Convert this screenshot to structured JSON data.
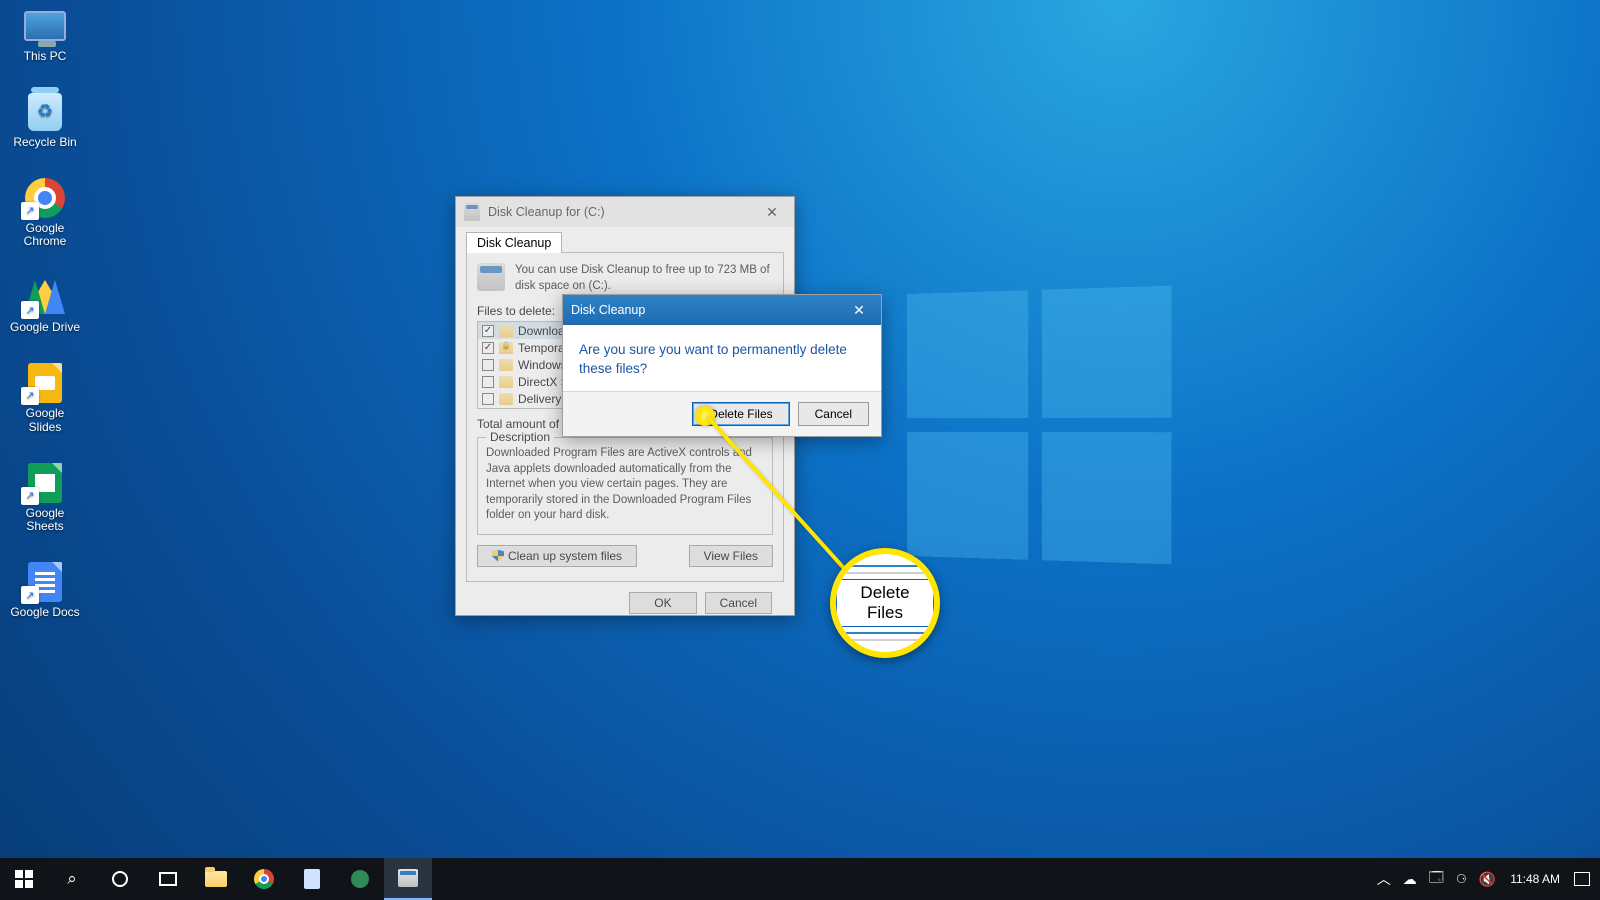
{
  "desktop_icons": [
    {
      "label": "This PC"
    },
    {
      "label": "Recycle Bin"
    },
    {
      "label": "Google Chrome"
    },
    {
      "label": "Google Drive"
    },
    {
      "label": "Google Slides"
    },
    {
      "label": "Google Sheets"
    },
    {
      "label": "Google Docs"
    }
  ],
  "cleanup_dialog": {
    "title": "Disk Cleanup for  (C:)",
    "tab": "Disk Cleanup",
    "info": "You can use Disk Cleanup to free up to 723 MB of disk space on  (C:).",
    "files_to_delete_label": "Files to delete:",
    "items": [
      {
        "checked": true,
        "label": "Downloaded Program Files",
        "locked": false
      },
      {
        "checked": true,
        "label": "Temporary Internet Files",
        "locked": true
      },
      {
        "checked": false,
        "label": "Windows error reports",
        "locked": false
      },
      {
        "checked": false,
        "label": "DirectX Shader Cache",
        "locked": false
      },
      {
        "checked": false,
        "label": "Delivery Optimization Files",
        "locked": false
      }
    ],
    "total_label": "Total amount of disk space you gain:",
    "description_legend": "Description",
    "description_text": "Downloaded Program Files are ActiveX controls and Java applets downloaded automatically from the Internet when you view certain pages. They are temporarily stored in the Downloaded Program Files folder on your hard disk.",
    "clean_system_btn": "Clean up system files",
    "view_files_btn": "View Files",
    "ok_btn": "OK",
    "cancel_btn": "Cancel"
  },
  "confirm_dialog": {
    "title": "Disk Cleanup",
    "message": "Are you sure you want to permanently delete these files?",
    "delete_btn": "Delete Files",
    "cancel_btn": "Cancel"
  },
  "magnifier_label": "Delete Files",
  "taskbar": {
    "time": "11:48 AM"
  }
}
